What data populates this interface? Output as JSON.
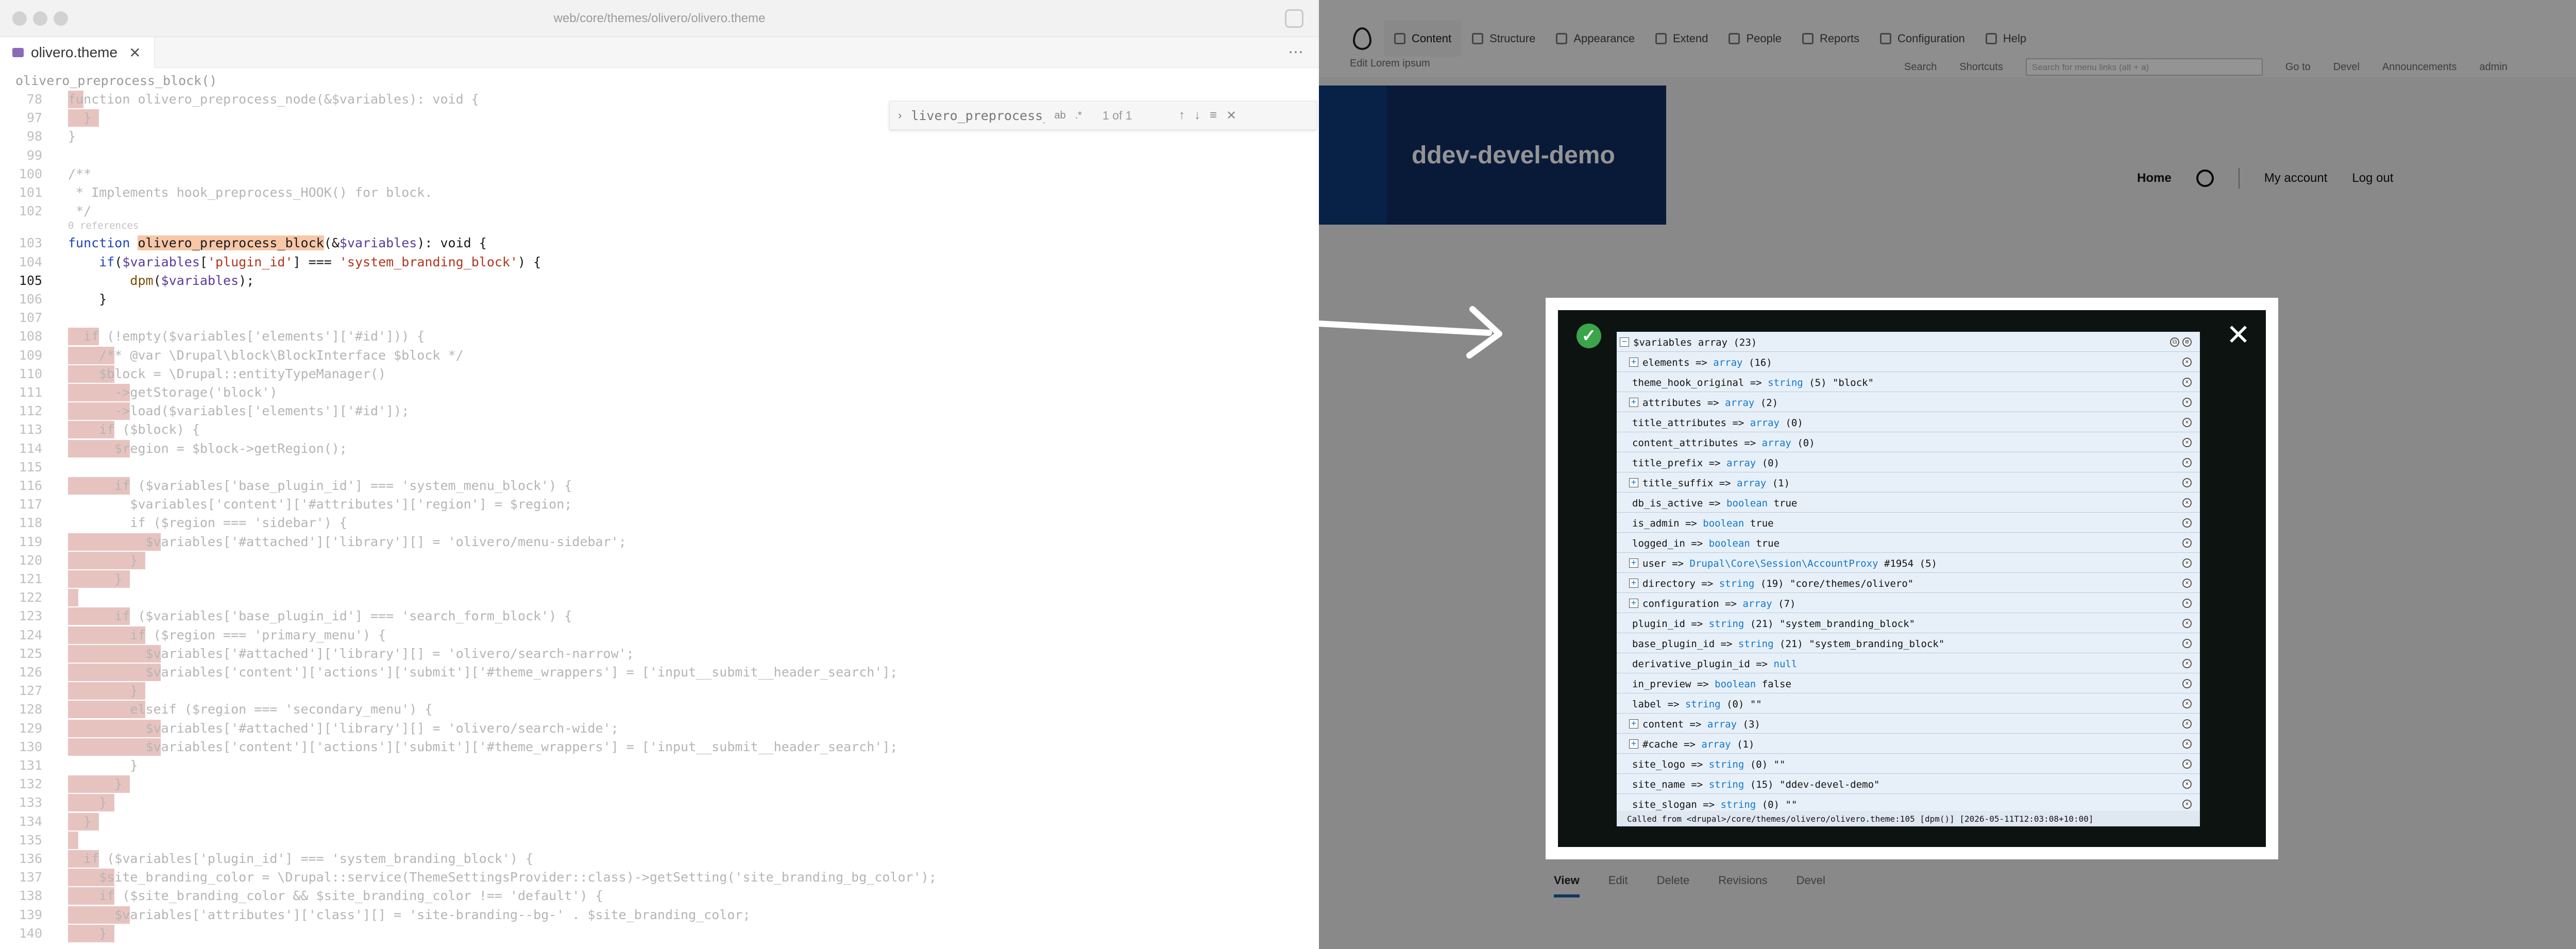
{
  "editor": {
    "window_title": "web/core/themes/olivero/olivero.theme",
    "tab_label": "olivero.theme",
    "breadcrumb": "olivero_preprocess_block()",
    "find": {
      "query": "livero_preprocess_block Aa",
      "match_case": "ab",
      "regex": ".*",
      "count": "1 of 1"
    },
    "refs_text": "0 references",
    "lines": [
      {
        "n": "78",
        "code": "function olivero_preprocess_node(&$variables): void {"
      },
      {
        "n": "97",
        "code": "  }"
      },
      {
        "n": "98",
        "code": "}"
      },
      {
        "n": "99",
        "code": ""
      },
      {
        "n": "100",
        "code": "/**"
      },
      {
        "n": "101",
        "code": " * Implements hook_preprocess_HOOK() for block."
      },
      {
        "n": "102",
        "code": " */"
      },
      {
        "n": "103",
        "code": "function olivero_preprocess_block(&$variables): void {"
      },
      {
        "n": "104",
        "code": "    if($variables['plugin_id'] === 'system_branding_block') {"
      },
      {
        "n": "105",
        "code": "        dpm($variables);"
      },
      {
        "n": "106",
        "code": "    }"
      },
      {
        "n": "107",
        "code": ""
      },
      {
        "n": "108",
        "code": "  if (!empty($variables['elements']['#id'])) {"
      },
      {
        "n": "109",
        "code": "    /** @var \\Drupal\\block\\BlockInterface $block */"
      },
      {
        "n": "110",
        "code": "    $block = \\Drupal::entityTypeManager()"
      },
      {
        "n": "111",
        "code": "      ->getStorage('block')"
      },
      {
        "n": "112",
        "code": "      ->load($variables['elements']['#id']);"
      },
      {
        "n": "113",
        "code": "    if ($block) {"
      },
      {
        "n": "114",
        "code": "      $region = $block->getRegion();"
      },
      {
        "n": "115",
        "code": ""
      },
      {
        "n": "116",
        "code": "      if ($variables['base_plugin_id'] === 'system_menu_block') {"
      },
      {
        "n": "117",
        "code": "        $variables['content']['#attributes']['region'] = $region;"
      },
      {
        "n": "118",
        "code": "        if ($region === 'sidebar') {"
      },
      {
        "n": "119",
        "code": "          $variables['#attached']['library'][] = 'olivero/menu-sidebar';"
      },
      {
        "n": "120",
        "code": "        }"
      },
      {
        "n": "121",
        "code": "      }"
      },
      {
        "n": "122",
        "code": ""
      },
      {
        "n": "123",
        "code": "      if ($variables['base_plugin_id'] === 'search_form_block') {"
      },
      {
        "n": "124",
        "code": "        if ($region === 'primary_menu') {"
      },
      {
        "n": "125",
        "code": "          $variables['#attached']['library'][] = 'olivero/search-narrow';"
      },
      {
        "n": "126",
        "code": "          $variables['content']['actions']['submit']['#theme_wrappers'] = ['input__submit__header_search'];"
      },
      {
        "n": "127",
        "code": "        }"
      },
      {
        "n": "128",
        "code": "        elseif ($region === 'secondary_menu') {"
      },
      {
        "n": "129",
        "code": "          $variables['#attached']['library'][] = 'olivero/search-wide';"
      },
      {
        "n": "130",
        "code": "          $variables['content']['actions']['submit']['#theme_wrappers'] = ['input__submit__header_search'];"
      },
      {
        "n": "131",
        "code": "        }"
      },
      {
        "n": "132",
        "code": "      }"
      },
      {
        "n": "133",
        "code": "    }"
      },
      {
        "n": "134",
        "code": "  }"
      },
      {
        "n": "135",
        "code": ""
      },
      {
        "n": "136",
        "code": "  if ($variables['plugin_id'] === 'system_branding_block') {"
      },
      {
        "n": "137",
        "code": "    $site_branding_color = \\Drupal::service(ThemeSettingsProvider::class)->getSetting('site_branding_bg_color');"
      },
      {
        "n": "138",
        "code": "    if ($site_branding_color && $site_branding_color !== 'default') {"
      },
      {
        "n": "139",
        "code": "      $variables['attributes']['class'][] = 'site-branding--bg-' . $site_branding_color;"
      },
      {
        "n": "140",
        "code": "    }"
      }
    ]
  },
  "browser": {
    "toolbar": {
      "items": [
        "Content",
        "Structure",
        "Appearance",
        "Extend",
        "People",
        "Reports",
        "Configuration",
        "Help"
      ],
      "edit_link": "Edit Lorem ipsum",
      "search": "Search",
      "shortcuts": "Shortcuts",
      "search_placeholder": "Search for menu links (alt + a)",
      "goto": "Go to",
      "devel": "Devel",
      "announcements": "Announcements",
      "user": "admin"
    },
    "site_name": "ddev-devel-demo",
    "nav": {
      "home": "Home",
      "account": "My account",
      "logout": "Log out"
    },
    "tabs": [
      "View",
      "Edit",
      "Delete",
      "Revisions",
      "Devel"
    ]
  },
  "krumo": {
    "header": "$variables array (23)",
    "rows": [
      {
        "key": "elements",
        "type": "array",
        "value": "(16)",
        "expand": true
      },
      {
        "key": "theme_hook_original",
        "type": "string",
        "value": "(5) \"block\"",
        "expand": false
      },
      {
        "key": "attributes",
        "type": "array",
        "value": "(2)",
        "expand": true
      },
      {
        "key": "title_attributes",
        "type": "array",
        "value": "(0)",
        "expand": false
      },
      {
        "key": "content_attributes",
        "type": "array",
        "value": "(0)",
        "expand": false
      },
      {
        "key": "title_prefix",
        "type": "array",
        "value": "(0)",
        "expand": false
      },
      {
        "key": "title_suffix",
        "type": "array",
        "value": "(1)",
        "expand": true
      },
      {
        "key": "db_is_active",
        "type": "boolean",
        "value": "true",
        "expand": false
      },
      {
        "key": "is_admin",
        "type": "boolean",
        "value": "true",
        "expand": false
      },
      {
        "key": "logged_in",
        "type": "boolean",
        "value": "true",
        "expand": false
      },
      {
        "key": "user",
        "type": "Drupal\\Core\\Session\\AccountProxy",
        "value": "#1954 (5)",
        "expand": true
      },
      {
        "key": "directory",
        "type": "string",
        "value": "(19) \"core/themes/olivero\"",
        "expand": true
      },
      {
        "key": "configuration",
        "type": "array",
        "value": "(7)",
        "expand": true
      },
      {
        "key": "plugin_id",
        "type": "string",
        "value": "(21) \"system_branding_block\"",
        "expand": false
      },
      {
        "key": "base_plugin_id",
        "type": "string",
        "value": "(21) \"system_branding_block\"",
        "expand": false
      },
      {
        "key": "derivative_plugin_id",
        "type": "null",
        "value": "",
        "expand": false
      },
      {
        "key": "in_preview",
        "type": "boolean",
        "value": "false",
        "expand": false
      },
      {
        "key": "label",
        "type": "string",
        "value": "(0) \"\"",
        "expand": false
      },
      {
        "key": "content",
        "type": "array",
        "value": "(3)",
        "expand": true
      },
      {
        "key": "#cache",
        "type": "array",
        "value": "(1)",
        "expand": true
      },
      {
        "key": "site_logo",
        "type": "string",
        "value": "(0) \"\"",
        "expand": false
      },
      {
        "key": "site_name",
        "type": "string",
        "value": "(15) \"ddev-devel-demo\"",
        "expand": false
      },
      {
        "key": "site_slogan",
        "type": "string",
        "value": "(0) \"\"",
        "expand": false
      }
    ],
    "footer": "Called from <drupal>/core/themes/olivero/olivero.theme:105 [dpm()] [2026-05-11T12:03:08+10:00]"
  },
  "colors": {
    "accent": "#1f5fa8",
    "brand": "#0e3a7a",
    "success": "#3aa54a"
  }
}
